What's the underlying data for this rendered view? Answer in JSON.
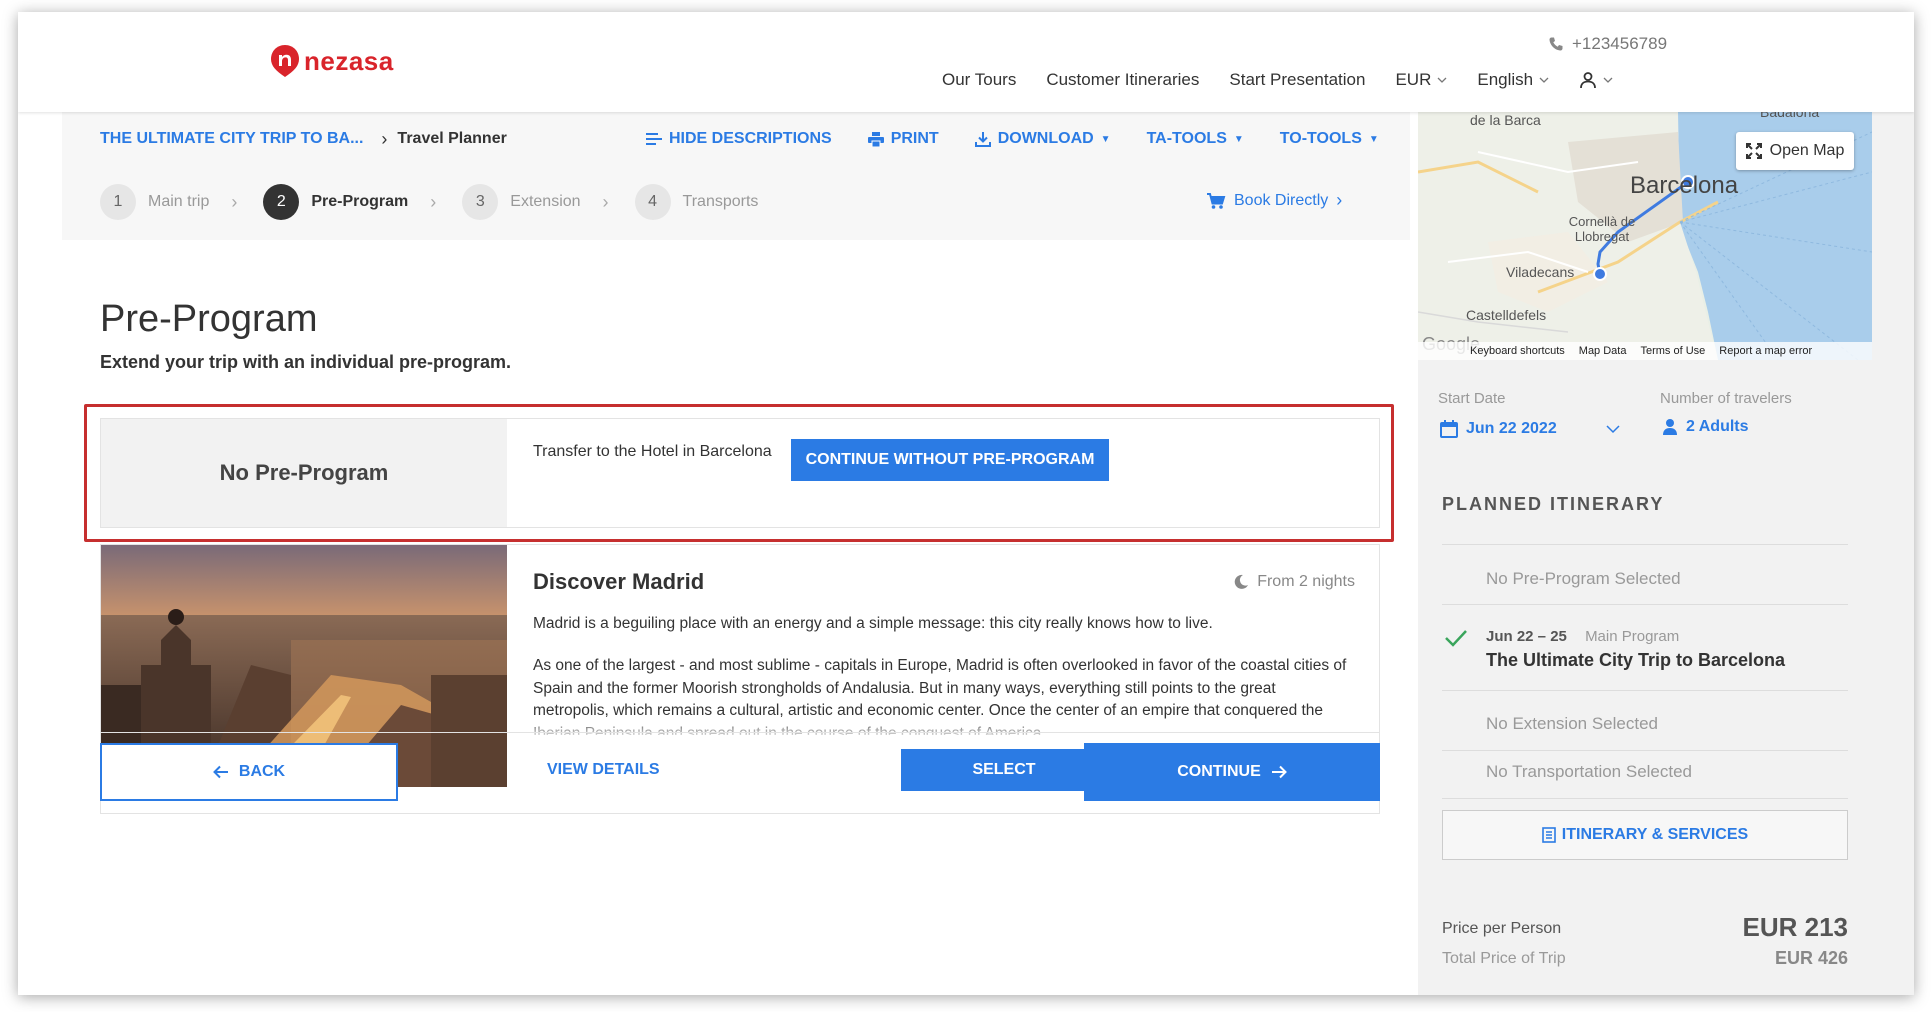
{
  "header": {
    "logo_text": "nezasa",
    "phone": "+123456789",
    "nav": [
      "Our Tours",
      "Customer Itineraries",
      "Start Presentation"
    ],
    "currency": "EUR",
    "language": "English"
  },
  "breadcrumb": {
    "trip": "THE ULTIMATE CITY TRIP TO BA...",
    "current": "Travel Planner"
  },
  "actions": {
    "hide_descriptions": "HIDE DESCRIPTIONS",
    "print": "PRINT",
    "download": "DOWNLOAD",
    "ta_tools": "TA-TOOLS",
    "to_tools": "TO-TOOLS"
  },
  "steps": [
    {
      "num": "1",
      "label": "Main trip",
      "active": false
    },
    {
      "num": "2",
      "label": "Pre-Program",
      "active": true
    },
    {
      "num": "3",
      "label": "Extension",
      "active": false
    },
    {
      "num": "4",
      "label": "Transports",
      "active": false
    }
  ],
  "book_directly": "Book Directly",
  "main": {
    "title": "Pre-Program",
    "subtitle": "Extend your trip with an individual pre-program.",
    "no_pre": {
      "label": "No Pre-Program",
      "description": "Transfer to the Hotel in Barcelona",
      "button": "CONTINUE WITHOUT PRE-PROGRAM"
    },
    "madrid": {
      "title": "Discover Madrid",
      "nights": "From 2 nights",
      "p1": "Madrid is a beguiling place with an energy and a simple message: this city really knows how to live.",
      "p2": "As one of the largest - and most sublime - capitals in Europe, Madrid is often overlooked in favor of the coastal cities of Spain and the former Moorish strongholds of Andalusia. But in many ways, everything still points to the great metropolis, which remains a cultural, artistic and economic center. Once the center of an empire that conquered the Iberian Peninsula and spread out in the course of the conquest of America.",
      "view_details": "VIEW DETAILS",
      "select": "SELECT"
    },
    "back": "BACK",
    "continue": "CONTINUE"
  },
  "map": {
    "open_map": "Open Map",
    "labels": {
      "barca_top": "de la Barca",
      "city": "Barcelona",
      "cornella": "Cornellà de Llobregat",
      "viladecans": "Viladecans",
      "castelldefels": "Castelldefels",
      "badalona": "Badalona",
      "google": "Google"
    },
    "footer": [
      "Keyboard shortcuts",
      "Map Data",
      "Terms of Use",
      "Report a map error"
    ]
  },
  "sidebar": {
    "start_date_label": "Start Date",
    "start_date": "Jun 22 2022",
    "travelers_label": "Number of travelers",
    "travelers": "2 Adults",
    "planned_title": "PLANNED ITINERARY",
    "no_pre": "No Pre-Program Selected",
    "main_dates": "Jun 22 – 25",
    "main_tag": "Main Program",
    "main_name": "The Ultimate City Trip to Barcelona",
    "no_ext": "No Extension Selected",
    "no_transport": "No Transportation Selected",
    "itinerary_button": "ITINERARY & SERVICES",
    "price_per_person_label": "Price per Person",
    "price_per_person": "EUR 213",
    "total_label": "Total Price of Trip",
    "total": "EUR 426"
  },
  "colors": {
    "primary": "#2b7be4",
    "brand": "#d9242b",
    "highlight_border": "#c62f2f"
  }
}
